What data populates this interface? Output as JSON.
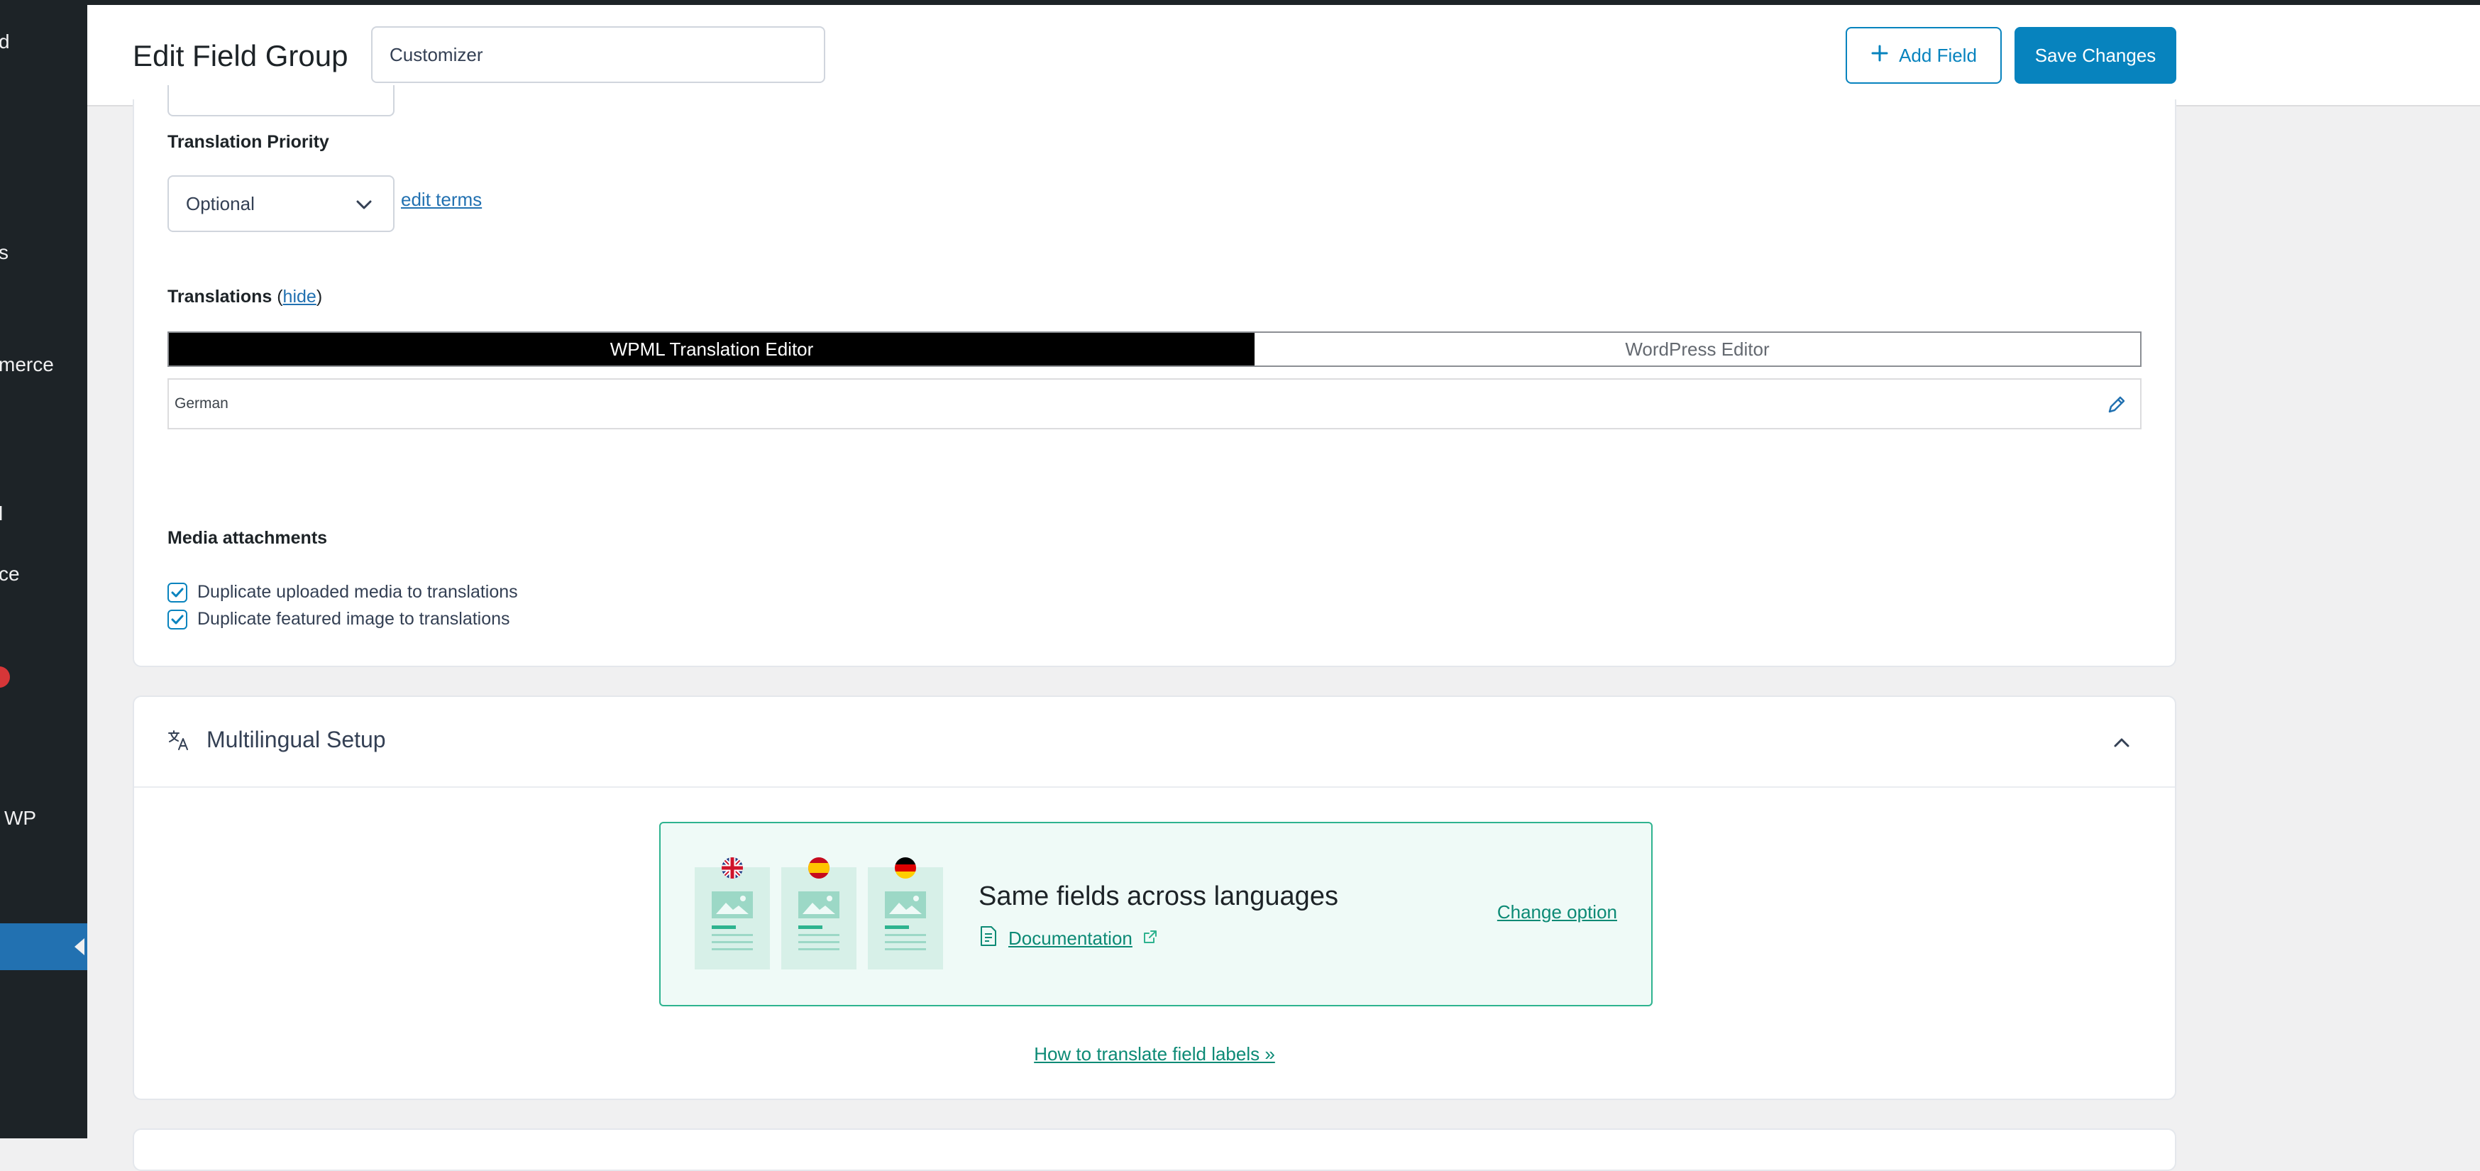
{
  "sidebar": {
    "fragments": [
      "d",
      "s",
      "merce",
      "l",
      "ce",
      "WP"
    ]
  },
  "header": {
    "title": "Edit Field Group",
    "group_name_value": "Customizer",
    "add_field_label": "Add Field",
    "save_label": "Save Changes"
  },
  "settings": {
    "translation_priority_label": "Translation Priority",
    "translation_priority_value": "Optional",
    "edit_terms_link": "edit terms",
    "translations_label": "Translations",
    "hide_link": "hide",
    "tabs": [
      "WPML Translation Editor",
      "WordPress Editor"
    ],
    "language_rows": [
      "German"
    ],
    "media_title": "Media attachments",
    "checkboxes": [
      {
        "label": "Duplicate uploaded media to translations",
        "checked": true
      },
      {
        "label": "Duplicate featured image to translations",
        "checked": true
      }
    ]
  },
  "multilingual": {
    "title": "Multilingual Setup",
    "option_heading": "Same fields across languages",
    "documentation_link": "Documentation",
    "change_option_link": "Change option",
    "howto_link": "How to translate field labels »"
  },
  "colors": {
    "primary": "#0783be",
    "sidebar": "#1d2327",
    "active_menu": "#2271b1",
    "teal": "#2eb38f"
  }
}
